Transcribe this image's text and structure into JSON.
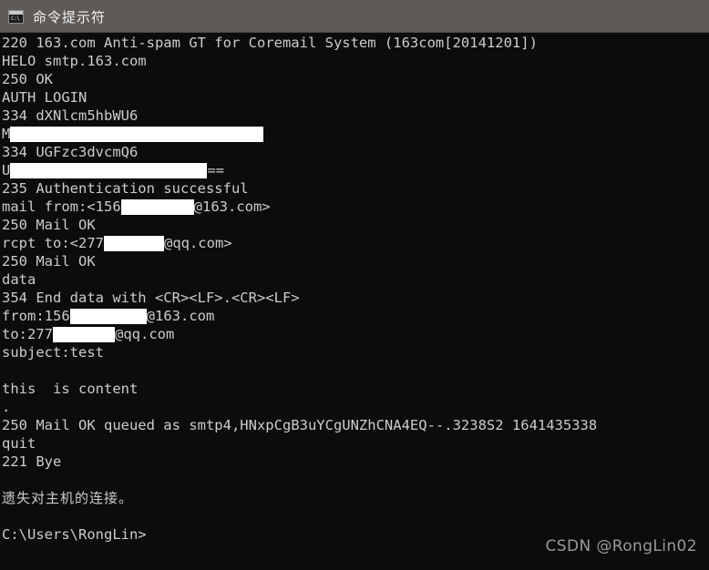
{
  "window": {
    "title": "命令提示符",
    "icon": "console-icon",
    "icon_prompt_text": "C:\\",
    "titlebar_color": "#5d5a57",
    "console_bg": "#0c0c0c",
    "console_fg": "#cccccc",
    "redaction_color": "#ffffff"
  },
  "console": {
    "lines": [
      {
        "text": "220 163.com Anti-spam GT for Coremail System (163com[20141201])"
      },
      {
        "text": "HELO smtp.163.com"
      },
      {
        "text": "250 OK"
      },
      {
        "text": "AUTH LOGIN"
      },
      {
        "text": "334 dXNlcm5hbWU6"
      },
      {
        "prefix": "M",
        "redacted_width": 278,
        "suffix": ""
      },
      {
        "text": "334 UGFzc3dvcmQ6"
      },
      {
        "prefix": "U",
        "redacted_width": 216,
        "suffix": "=="
      },
      {
        "text": "235 Authentication successful"
      },
      {
        "prefix": "mail from:<156",
        "redacted_width": 80,
        "suffix": "@163.com>"
      },
      {
        "text": "250 Mail OK"
      },
      {
        "prefix": "rcpt to:<277",
        "redacted_width": 66,
        "suffix": "@qq.com>"
      },
      {
        "text": "250 Mail OK"
      },
      {
        "text": "data"
      },
      {
        "text": "354 End data with <CR><LF>.<CR><LF>"
      },
      {
        "prefix": "from:156",
        "redacted_width": 84,
        "suffix": "@163.com"
      },
      {
        "prefix": "to:277",
        "redacted_width": 68,
        "suffix": "@qq.com"
      },
      {
        "text": "subject:test"
      },
      {
        "text": ""
      },
      {
        "text": "this  is content"
      },
      {
        "text": "."
      },
      {
        "text": "250 Mail OK queued as smtp4,HNxpCgB3uYCgUNZhCNA4EQ--.3238S2 1641435338"
      },
      {
        "text": "quit"
      },
      {
        "text": "221 Bye"
      },
      {
        "text": ""
      },
      {
        "text": "遗失对主机的连接。",
        "cjk": true
      },
      {
        "text": ""
      },
      {
        "text": "C:\\Users\\RongLin>"
      }
    ]
  },
  "watermark": {
    "text": "CSDN @RongLin02"
  }
}
